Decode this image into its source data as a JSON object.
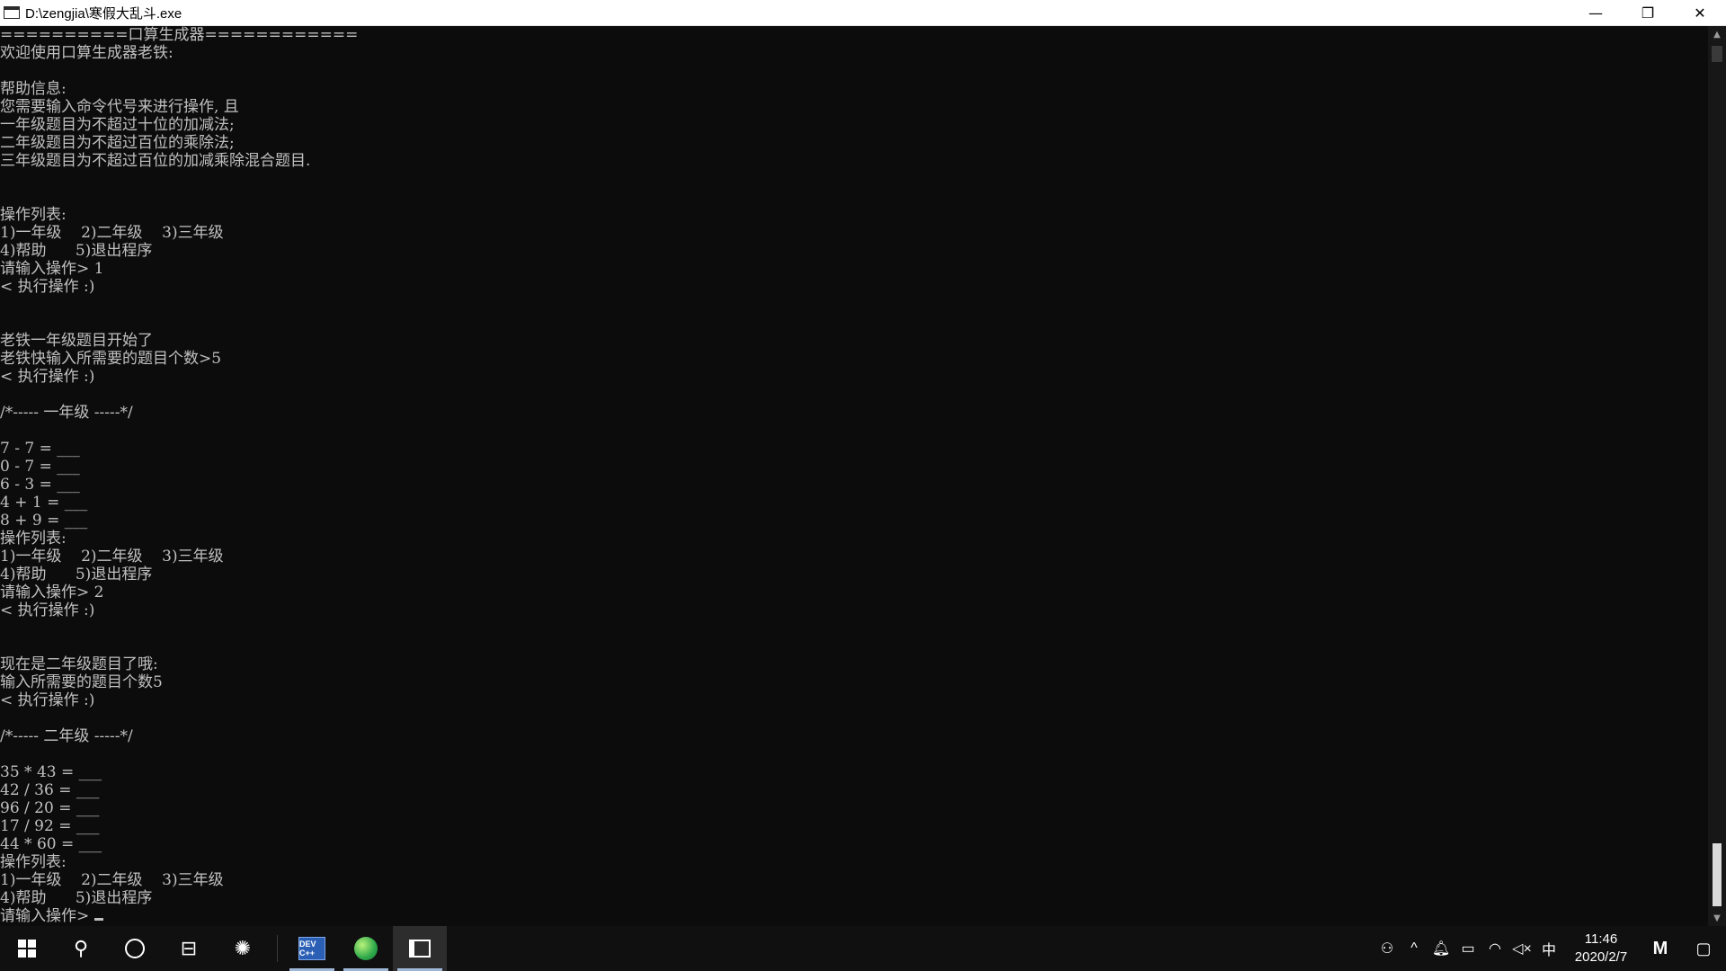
{
  "window": {
    "title": "D:\\zengjia\\寒假大乱斗.exe",
    "controls": {
      "minimize": "—",
      "restore": "❐",
      "close": "✕"
    }
  },
  "console": {
    "lines": [
      "==========口算生成器============",
      "欢迎使用口算生成器老铁:",
      "",
      "帮助信息:",
      "您需要输入命令代号来进行操作, 且",
      "一年级题目为不超过十位的加减法;",
      "二年级题目为不超过百位的乘除法;",
      "三年级题目为不超过百位的加减乘除混合题目.",
      "",
      "",
      "操作列表:",
      "1)一年级    2)二年级    3)三年级",
      "4)帮助      5)退出程序",
      "请输入操作> 1",
      "< 执行操作 :)",
      "",
      "",
      "老铁一年级题目开始了",
      "老铁快输入所需要的题目个数>5",
      "< 执行操作 :)",
      "",
      "/*----- 一年级 -----*/",
      "",
      "7 - 7 = ___",
      "0 - 7 = ___",
      "6 - 3 = ___",
      "4 + 1 = ___",
      "8 + 9 = ___",
      "操作列表:",
      "1)一年级    2)二年级    3)三年级",
      "4)帮助      5)退出程序",
      "请输入操作> 2",
      "< 执行操作 :)",
      "",
      "",
      "现在是二年级题目了哦:",
      "输入所需要的题目个数5",
      "< 执行操作 :)",
      "",
      "/*----- 二年级 -----*/",
      "",
      "35 * 43 = ___",
      "42 / 36 = ___",
      "96 / 20 = ___",
      "17 / 92 = ___",
      "44 * 60 = ___",
      "操作列表:",
      "1)一年级    2)二年级    3)三年级",
      "4)帮助      5)退出程序"
    ],
    "prompt": "请输入操作> "
  },
  "taskbar": {
    "apps": [
      {
        "name": "start",
        "icon": "windows-logo-icon"
      },
      {
        "name": "search",
        "icon": "search-icon"
      },
      {
        "name": "cortana",
        "icon": "cortana-circle-icon"
      },
      {
        "name": "task-view",
        "icon": "task-view-icon"
      },
      {
        "name": "app-swirl",
        "icon": "swirl-app-icon"
      },
      {
        "name": "dev-cpp",
        "icon": "devcpp-icon",
        "label": "DEV C++"
      },
      {
        "name": "browser",
        "icon": "green-browser-icon"
      },
      {
        "name": "console",
        "icon": "console-window-icon"
      }
    ],
    "tray": {
      "ime": "中",
      "time": "11:46",
      "date": "2020/2/7"
    }
  },
  "colors": {
    "console_bg": "#0c0c0c",
    "console_fg": "#c0c0c0",
    "taskbar_bg": "#101010",
    "titlebar_bg": "#ffffff"
  }
}
